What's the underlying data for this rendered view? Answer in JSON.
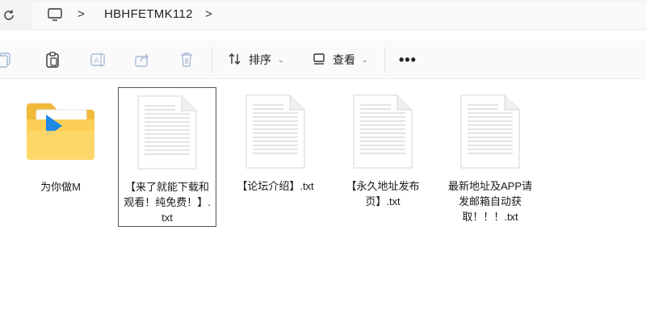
{
  "address": {
    "breadcrumb": "HBHFETMK112",
    "separator": ">"
  },
  "toolbar": {
    "sort_label": "排序",
    "view_label": "查看",
    "more_label": "•••"
  },
  "files": [
    {
      "name": "为你做M",
      "type": "folder"
    },
    {
      "name": "【来了就能下载和观看！纯免费！】.txt",
      "type": "txt"
    },
    {
      "name": "【论坛介绍】.txt",
      "type": "txt"
    },
    {
      "name": "【永久地址发布页】.txt",
      "type": "txt"
    },
    {
      "name": "最新地址及APP请发邮箱自动获取！！！.txt",
      "type": "txt"
    }
  ],
  "icons": [
    "refresh-icon",
    "pc-icon",
    "copy-icon",
    "paste-icon",
    "rename-icon",
    "share-icon",
    "delete-icon",
    "sort-icon",
    "view-icon",
    "more-icon",
    "folder-icon",
    "txt-file-icon"
  ]
}
